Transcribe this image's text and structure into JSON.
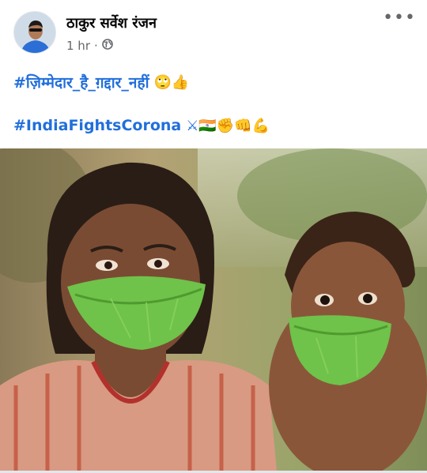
{
  "post": {
    "author_name": "ठाकुर सर्वेश रंजन",
    "timestamp": "1 hr",
    "separator": "·",
    "audience_icon": "globe-icon",
    "more_icon": "more-options-icon",
    "more_label": "•••",
    "hashtag1": "#ज़िम्मेदार_है_ग़द्दार_नहीं",
    "hashtag1_emojis": "🙄👍",
    "hashtag2": "#IndiaFightsCorona",
    "hashtag2_emojis": "⚔🇮🇳✊👊💪"
  },
  "colors": {
    "link": "#216fdb",
    "meta": "#65676b",
    "leaf": "#6fc24a"
  }
}
